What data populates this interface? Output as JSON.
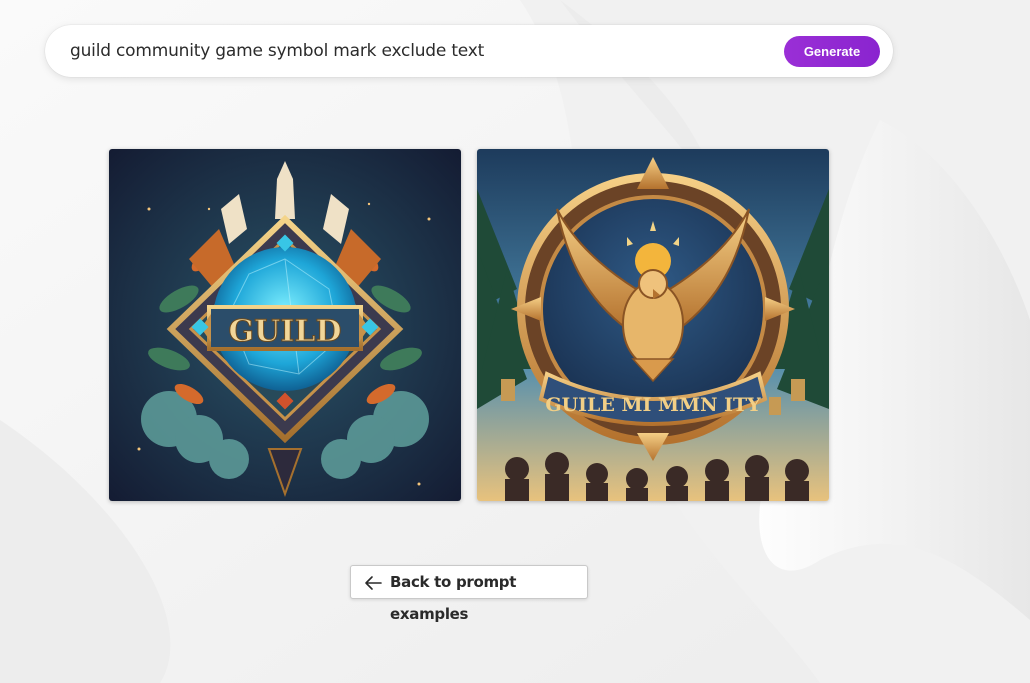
{
  "search": {
    "query": "guild community game symbol mark exclude text",
    "generate_label": "Generate",
    "accent_color": "#8e28d2"
  },
  "results": [
    {
      "id": "image-1",
      "emblem_text": "GUILD",
      "icon": "guild-crest-emblem"
    },
    {
      "id": "image-2",
      "emblem_text": "GUILE MI MMN ITY",
      "icon": "eagle-badge-emblem"
    }
  ],
  "back": {
    "label": "Back to prompt examples",
    "icon": "arrow-left-icon"
  }
}
